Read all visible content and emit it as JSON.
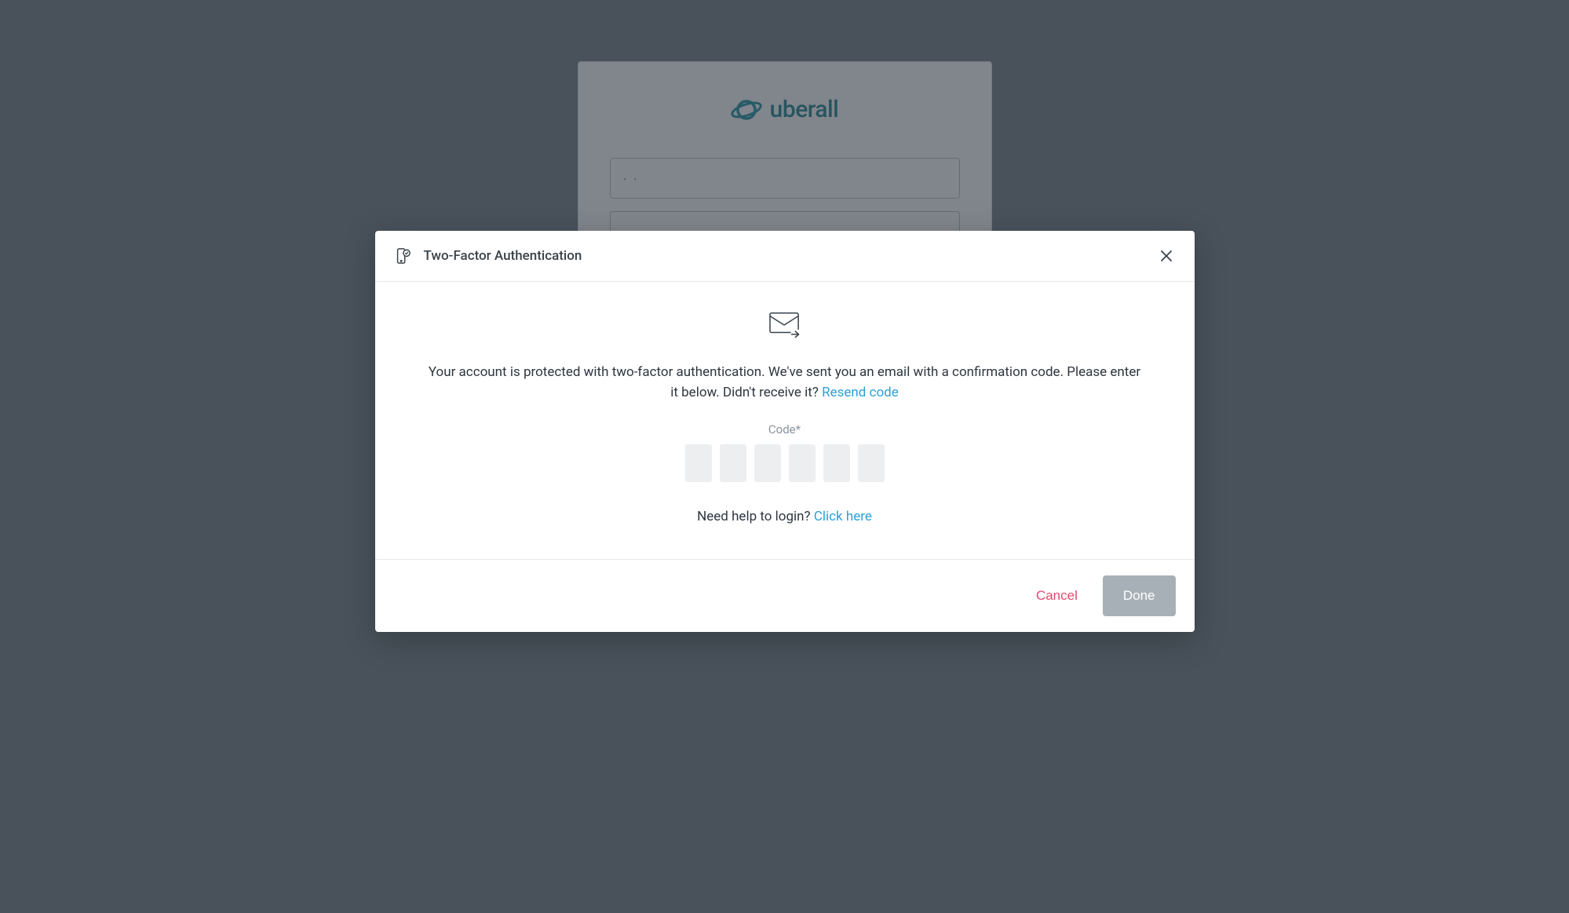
{
  "login": {
    "brand": "uberall",
    "input1_value": "·  ·"
  },
  "modal": {
    "title": "Two-Factor Authentication",
    "instruction": "Your account is protected with two-factor authentication. We've sent you an email with a confirmation code. Please enter it below. Didn't receive it? ",
    "resend_link": "Resend code",
    "code_label": "Code*",
    "help_text": "Need help to login? ",
    "help_link": "Click here",
    "cancel_label": "Cancel",
    "done_label": "Done"
  }
}
